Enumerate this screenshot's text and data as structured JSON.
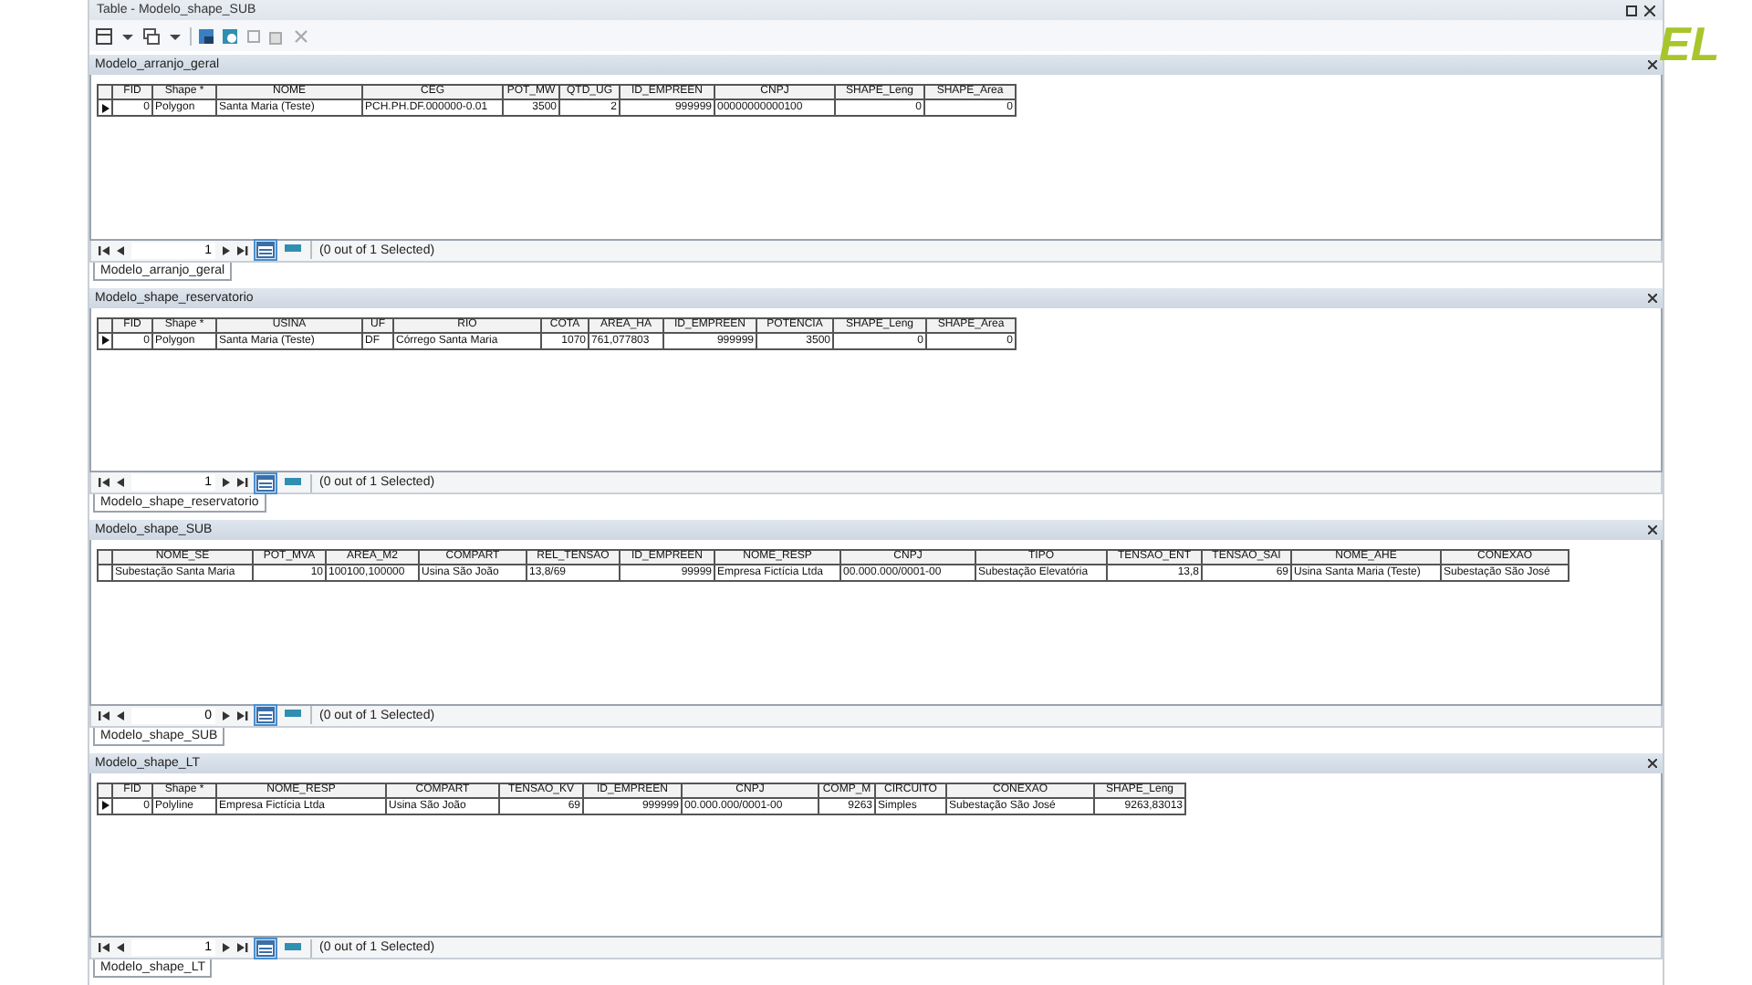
{
  "window": {
    "title": "Table - Modelo_shape_SUB"
  },
  "logo_text": "EL",
  "tables": [
    {
      "title": "Modelo_arranjo_geral",
      "columns": [
        "FID",
        "Shape *",
        "NOME",
        "CEG",
        "POT_MW",
        "QTD_UG",
        "ID_EMPREEN",
        "CNPJ",
        "SHAPE_Leng",
        "SHAPE_Area"
      ],
      "rows": [
        {
          "current": true,
          "cells": [
            "0",
            "Polygon",
            "Santa Maria (Teste)",
            "PCH.PH.DF.000000-0.01",
            "3500",
            "2",
            "999999",
            "00000000000100",
            "0",
            "0"
          ]
        }
      ],
      "page": "1",
      "selection": "(0 out of 1 Selected)",
      "tab": "Modelo_arranjo_geral"
    },
    {
      "title": "Modelo_shape_reservatorio",
      "columns": [
        "FID",
        "Shape *",
        "USINA",
        "UF",
        "RIO",
        "COTA",
        "AREA_HA",
        "ID_EMPREEN",
        "POTENCIA",
        "SHAPE_Leng",
        "SHAPE_Area"
      ],
      "rows": [
        {
          "current": true,
          "cells": [
            "0",
            "Polygon",
            "Santa Maria (Teste)",
            "DF",
            "Córrego Santa Maria",
            "1070",
            "761,077803",
            "999999",
            "3500",
            "0",
            "0"
          ]
        }
      ],
      "page": "1",
      "selection": "(0 out of 1 Selected)",
      "tab": "Modelo_shape_reservatorio"
    },
    {
      "title": "Modelo_shape_SUB",
      "columns": [
        "NOME_SE",
        "POT_MVA",
        "AREA_M2",
        "COMPART",
        "REL_TENSAO",
        "ID_EMPREEN",
        "NOME_RESP",
        "CNPJ",
        "TIPO",
        "TENSAO_ENT",
        "TENSAO_SAI",
        "NOME_AHE",
        "CONEXAO"
      ],
      "rows": [
        {
          "current": false,
          "cells": [
            "Subestação Santa Maria",
            "10",
            "100100,100000",
            "Usina São João",
            "13,8/69",
            "99999",
            "Empresa Fictícia Ltda",
            "00.000.000/0001-00",
            "Subestação Elevatória",
            "13,8",
            "69",
            "Usina Santa Maria (Teste)",
            "Subestação São José"
          ]
        }
      ],
      "page": "0",
      "selection": "(0 out of 1 Selected)",
      "tab": "Modelo_shape_SUB"
    },
    {
      "title": "Modelo_shape_LT",
      "columns": [
        "FID",
        "Shape *",
        "NOME_RESP",
        "COMPART",
        "TENSAO_KV",
        "ID_EMPREEN",
        "CNPJ",
        "COMP_M",
        "CIRCUITO",
        "CONEXAO",
        "SHAPE_Leng"
      ],
      "rows": [
        {
          "current": true,
          "cells": [
            "0",
            "Polyline",
            "Empresa Fictícia Ltda",
            "Usina São João",
            "69",
            "999999",
            "00.000.000/0001-00",
            "9263",
            "Simples",
            "Subestação São José",
            "9263,83013"
          ]
        }
      ],
      "page": "1",
      "selection": "(0 out of 1 Selected)",
      "tab": "Modelo_shape_LT"
    }
  ]
}
